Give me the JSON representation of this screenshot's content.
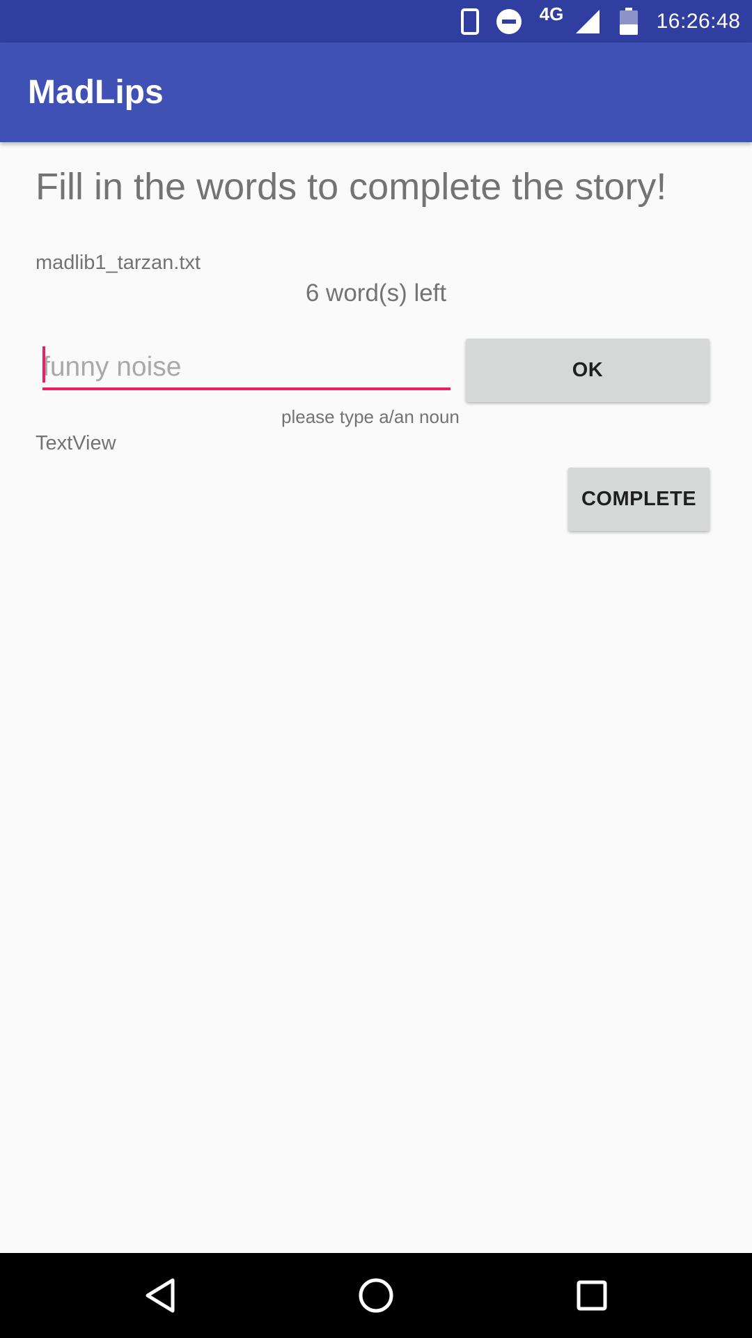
{
  "status_bar": {
    "time": "16:26:48",
    "network": "4G",
    "battery_level": "37",
    "icons": [
      "phone-icon",
      "do-not-disturb-icon",
      "signal-icon",
      "battery-icon"
    ],
    "background_color": "#303f9f"
  },
  "app_bar": {
    "title": "MadLips",
    "background_color": "#3f51b5"
  },
  "main": {
    "heading": "Fill in the words to complete the story!",
    "filename": "madlib1_tarzan.txt",
    "words_left": "6 word(s) left",
    "word_input": {
      "value": "",
      "placeholder": "funny noise",
      "accent_color": "#e91e63"
    },
    "ok_button_label": "OK",
    "hint": "please type a/an noun",
    "textview": "TextView",
    "complete_button_label": "COMPLETE"
  },
  "nav_bar": {
    "icons": [
      "back-icon",
      "home-icon",
      "recents-icon"
    ]
  }
}
